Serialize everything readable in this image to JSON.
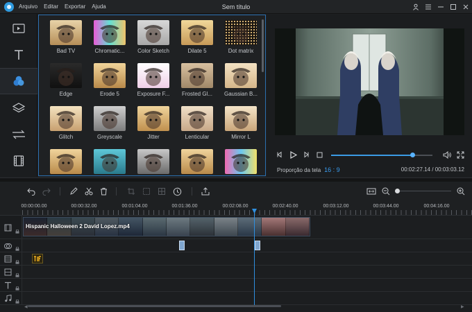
{
  "titlebar": {
    "title": "Sem título",
    "menu": [
      "Arquivo",
      "Editar",
      "Exportar",
      "Ajuda"
    ],
    "controls": [
      "user-icon",
      "list-icon",
      "minimize-icon",
      "maximize-icon",
      "close-icon"
    ]
  },
  "tools": [
    "media-icon",
    "text-icon",
    "filters-icon",
    "overlay-icon",
    "transitions-icon",
    "film-icon"
  ],
  "active_tool": "filters-icon",
  "effects": [
    {
      "label": "Bad TV",
      "style": "badtv"
    },
    {
      "label": "Chromatic...",
      "style": "chromatic"
    },
    {
      "label": "Color Sketch",
      "style": "sketch"
    },
    {
      "label": "Dilate 5",
      "style": "dilate"
    },
    {
      "label": "Dot matrix",
      "style": "dots"
    },
    {
      "label": "Edge",
      "style": "edge"
    },
    {
      "label": "Erode 5",
      "style": "erode"
    },
    {
      "label": "Exposure F...",
      "style": "exposure"
    },
    {
      "label": "Frosted Gl...",
      "style": "frosted"
    },
    {
      "label": "Gaussian B...",
      "style": "gaussian"
    },
    {
      "label": "Glitch",
      "style": "glitch"
    },
    {
      "label": "Greyscale",
      "style": "grey"
    },
    {
      "label": "Jitter",
      "style": "jitter"
    },
    {
      "label": "Lenticular",
      "style": "lenticular"
    },
    {
      "label": "Mirror L",
      "style": "mirror"
    },
    {
      "label": "",
      "style": "normal"
    },
    {
      "label": "",
      "style": "teal"
    },
    {
      "label": "",
      "style": "greyscale2"
    },
    {
      "label": "",
      "style": "normal"
    },
    {
      "label": "",
      "style": "rainbow"
    }
  ],
  "player": {
    "aspect_label": "Proporção da tela",
    "aspect_value": "16 : 9",
    "time": "00:02:27.14 / 00:03:03.12",
    "progress": 0.8
  },
  "toolbar": {
    "left": [
      "undo-icon",
      "redo-icon",
      "pen-icon",
      "cut-icon",
      "delete-icon",
      "crop-icon",
      "split-icon",
      "mosaic-icon",
      "clock-icon",
      "share-icon"
    ],
    "right": [
      "fit-icon",
      "zoom-out-icon",
      "zoom-in-icon"
    ],
    "zoom_level": 0.05
  },
  "ruler": {
    "labels": [
      "00:00:00.00",
      "00:00:32.00",
      "00:01:04.00",
      "00:01:36.00",
      "00:02:08.00",
      "00:02:40.00",
      "00:03:12.00",
      "00:03:44.00",
      "00:04:16.00"
    ]
  },
  "timeline": {
    "clip_title": "Hispanic Halloween 2  David Lopez.mp4",
    "track_icons": [
      "video-track-icon",
      "transition-track-icon",
      "overlay-track-icon",
      "filter-track-icon",
      "text-track-icon",
      "music-track-icon"
    ],
    "playhead_time": "00:02:27.14"
  },
  "colors": {
    "accent": "#2f8fe0",
    "panel_border": "#2b6fb0",
    "bg": "#1e2022"
  }
}
